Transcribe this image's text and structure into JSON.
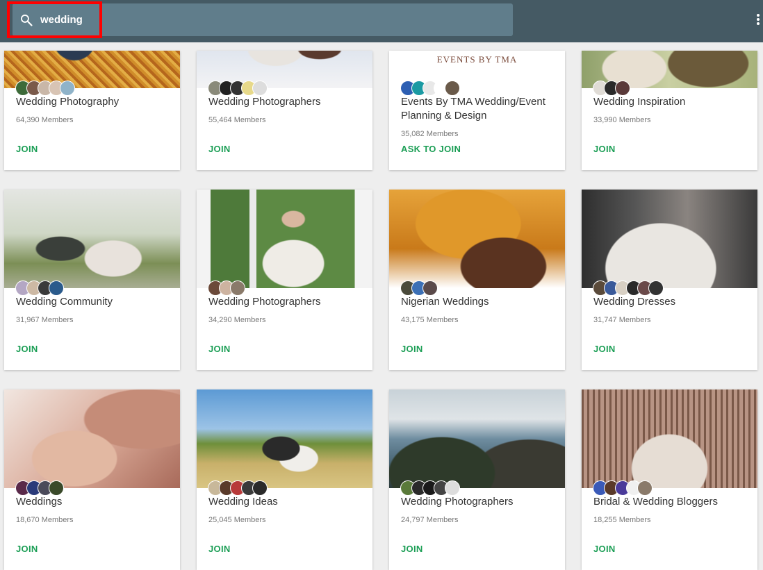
{
  "search": {
    "query": "wedding"
  },
  "cards": [
    {
      "title": "Wedding Photography",
      "members": "64,390 Members",
      "action": "JOIN"
    },
    {
      "title": "Wedding Photographers",
      "members": "55,464 Members",
      "action": "JOIN"
    },
    {
      "title": "Events By TMA Wedding/Event Planning & Design",
      "members": "35,082 Members",
      "action": "ASK TO JOIN",
      "logo_text": "EVENTS BY TMA"
    },
    {
      "title": "Wedding Inspiration",
      "members": "33,990 Members",
      "action": "JOIN"
    },
    {
      "title": "Wedding Community",
      "members": "31,967 Members",
      "action": "JOIN"
    },
    {
      "title": "Wedding Photographers",
      "members": "34,290 Members",
      "action": "JOIN"
    },
    {
      "title": "Nigerian Weddings",
      "members": "43,175 Members",
      "action": "JOIN"
    },
    {
      "title": "Wedding Dresses",
      "members": "31,747 Members",
      "action": "JOIN"
    },
    {
      "title": "Weddings",
      "members": "18,670 Members",
      "action": "JOIN"
    },
    {
      "title": "Wedding Ideas",
      "members": "25,045 Members",
      "action": "JOIN"
    },
    {
      "title": "Wedding Photographers",
      "members": "24,797 Members",
      "action": "JOIN"
    },
    {
      "title": "Bridal & Wedding Bloggers",
      "members": "18,255 Members",
      "action": "JOIN"
    }
  ],
  "colors": {
    "topbar": "#455a64",
    "search_box": "#607d8b",
    "join": "#1b9e55",
    "highlight": "#ff0000"
  },
  "icons": {
    "search": "search-icon",
    "menu": "more-vertical-icon"
  }
}
